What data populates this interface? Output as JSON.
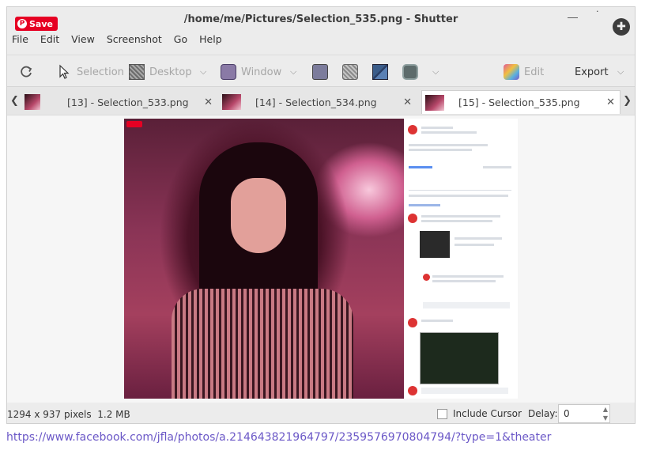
{
  "window": {
    "title": "/home/me/Pictures/Selection_535.png - Shutter",
    "save_badge": "Save"
  },
  "menu": [
    "File",
    "Edit",
    "View",
    "Screenshot",
    "Go",
    "Help"
  ],
  "toolbar": {
    "selection_label": "Selection",
    "desktop_label": "Desktop",
    "window_label": "Window",
    "edit_label": "Edit",
    "export_label": "Export"
  },
  "tabs": [
    {
      "label": "[13] - Selection_533.png",
      "active": false
    },
    {
      "label": "[14] - Selection_534.png",
      "active": false
    },
    {
      "label": "[15] - Selection_535.png",
      "active": true
    }
  ],
  "status": {
    "dimensions": "1294 x 937 pixels",
    "size": "1.2 MB",
    "include_cursor_label": "Include Cursor",
    "include_cursor_checked": false,
    "delay_label": "Delay:",
    "delay_value": "0"
  },
  "url": "https://www.facebook.com/jfla/photos/a.214643821964797/2359576970804794/?type=1&theater",
  "colors": {
    "pinterest_red": "#e60023",
    "link": "#6b58c7"
  }
}
